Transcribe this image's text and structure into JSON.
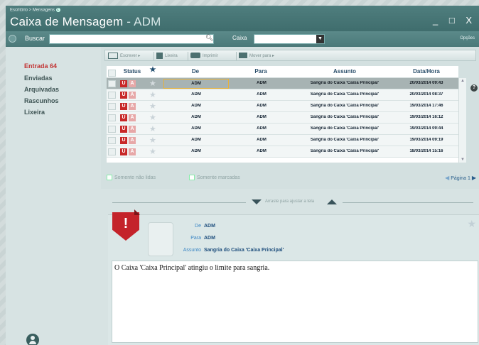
{
  "header": {
    "breadcrumb": "Escritório > Mensagens",
    "breadcrumb_badge": "c",
    "title": "Caixa de Mensagem",
    "title_separator": "-",
    "title_user": "ADM",
    "window_controls": "_ □ X"
  },
  "searchbar": {
    "search_label": "Buscar",
    "search_value": "",
    "caixa_label": "Caixa",
    "caixa_value": "",
    "options_label": "Opções"
  },
  "sidebar": {
    "items": [
      {
        "label": "Entrada",
        "count": "64",
        "active": true
      },
      {
        "label": "Enviadas",
        "count": ""
      },
      {
        "label": "Arquivadas",
        "count": ""
      },
      {
        "label": "Rascunhos",
        "count": ""
      },
      {
        "label": "Lixeira",
        "count": ""
      }
    ]
  },
  "toolbar": {
    "write": "Escrever",
    "trash": "Lixeira",
    "print": "Imprimir",
    "move": "Mover para"
  },
  "table": {
    "headers": {
      "status": "Status",
      "de": "De",
      "para": "Para",
      "assunto": "Assunto",
      "data": "Data/Hora"
    },
    "rows": [
      {
        "u": "U",
        "a": "A",
        "de": "ADM",
        "para": "ADM",
        "assunto": "Sangria do Caixa 'Caixa Principal'",
        "data": "20/03/2014 09:43"
      },
      {
        "u": "U",
        "a": "A",
        "de": "ADM",
        "para": "ADM",
        "assunto": "Sangria do Caixa 'Caixa Principal'",
        "data": "20/03/2014 08:37"
      },
      {
        "u": "U",
        "a": "A",
        "de": "ADM",
        "para": "ADM",
        "assunto": "Sangria do Caixa 'Caixa Principal'",
        "data": "19/03/2014 17:46"
      },
      {
        "u": "U",
        "a": "A",
        "de": "ADM",
        "para": "ADM",
        "assunto": "Sangria do Caixa 'Caixa Principal'",
        "data": "19/03/2014 16:12"
      },
      {
        "u": "U",
        "a": "A",
        "de": "ADM",
        "para": "ADM",
        "assunto": "Sangria do Caixa 'Caixa Principal'",
        "data": "19/03/2014 09:44"
      },
      {
        "u": "U",
        "a": "A",
        "de": "ADM",
        "para": "ADM",
        "assunto": "Sangria do Caixa 'Caixa Principal'",
        "data": "19/03/2014 09:19"
      },
      {
        "u": "U",
        "a": "A",
        "de": "ADM",
        "para": "ADM",
        "assunto": "Sangria do Caixa 'Caixa Principal'",
        "data": "18/03/2014 15:16"
      }
    ]
  },
  "filters": {
    "unread_only": "Somente não lidas",
    "marked_only": "Somente marcadas"
  },
  "pager": {
    "label": "Página",
    "page": "1"
  },
  "divider": {
    "hint": "Arraste para ajustar a tela"
  },
  "preview": {
    "alert_symbol": "!",
    "de_label": "De",
    "de_value": "ADM",
    "para_label": "Para",
    "para_value": "ADM",
    "assunto_label": "Assunto",
    "assunto_value": "Sangria do Caixa 'Caixa Principal'",
    "body": "O Caixa 'Caixa Principal' atingiu o limite para sangria."
  },
  "icons": {
    "search": "search-icon",
    "help": "help-icon",
    "user": "user-icon",
    "star": "star-icon"
  },
  "colors": {
    "accent": "#4b7979",
    "alert": "#c4232a",
    "link": "#2a5f8c"
  }
}
